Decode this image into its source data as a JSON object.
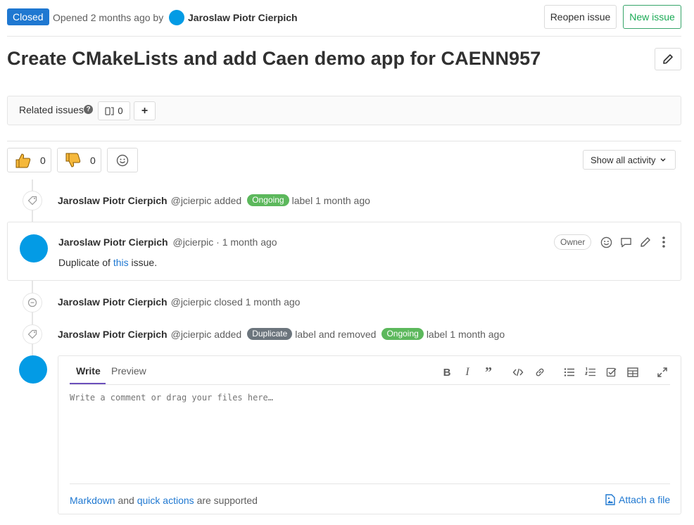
{
  "header": {
    "status": "Closed",
    "opened_text": "Opened 2 months ago by",
    "author": "Jaroslaw Piotr Cierpich",
    "reopen_label": "Reopen issue",
    "new_issue_label": "New issue"
  },
  "title": "Create CMakeLists and add Caen demo app for CAENN957",
  "related": {
    "label": "Related issues",
    "count": "0"
  },
  "awards": {
    "thumbs_up_count": "0",
    "thumbs_down_count": "0"
  },
  "activity_filter": "Show all activity",
  "timeline": {
    "event1": {
      "name": "Jaroslaw Piotr Cierpich",
      "handle": "@jcierpic added",
      "label": "Ongoing",
      "after": "label 1 month ago"
    },
    "note": {
      "name": "Jaroslaw Piotr Cierpich",
      "meta": "@jcierpic · 1 month ago",
      "body_prefix": "Duplicate of",
      "body_link": "this",
      "body_suffix": "issue.",
      "role": "Owner"
    },
    "event2": {
      "name": "Jaroslaw Piotr Cierpich",
      "text": "@jcierpic closed 1 month ago"
    },
    "event3": {
      "name": "Jaroslaw Piotr Cierpich",
      "handle": "@jcierpic added",
      "label1": "Duplicate",
      "middle": "label and removed",
      "label2": "Ongoing",
      "after": "label 1 month ago"
    }
  },
  "comment_form": {
    "tab_write": "Write",
    "tab_preview": "Preview",
    "placeholder": "Write a comment or drag your files here…",
    "footer_link1": "Markdown",
    "footer_and": "and",
    "footer_link2": "quick actions",
    "footer_suffix": "are supported",
    "attach_label": "Attach a file"
  },
  "colors": {
    "closed_badge": "#1f78d1",
    "ongoing_label": "#5cb85c",
    "duplicate_label": "#6c757d",
    "avatar": "#039be5",
    "new_issue_border": "#37a56a"
  }
}
